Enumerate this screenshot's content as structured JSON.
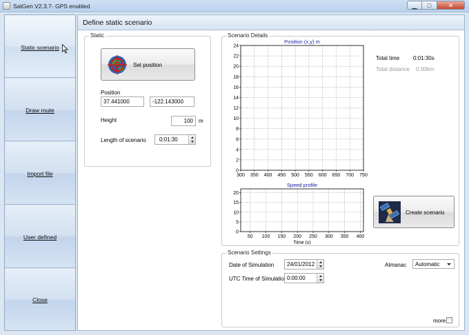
{
  "window": {
    "title": "SatGen V2.3.7- GPS enabled",
    "min_glyph": "▁",
    "max_glyph": "□",
    "close_glyph": "✕"
  },
  "nav": {
    "items": [
      {
        "label": "Static scenario"
      },
      {
        "label": "Draw route"
      },
      {
        "label": "Import file"
      },
      {
        "label": "User defined"
      },
      {
        "label": "Close"
      }
    ]
  },
  "header": {
    "title": "Define static scenario"
  },
  "static_group": {
    "title": "Static",
    "set_position_label": "Set position",
    "position_label": "Position",
    "latitude": "37.441000",
    "longitude": "-122.143000",
    "height_label": "Height",
    "height_value": "100",
    "height_unit": "m",
    "length_label": "Length of scenario",
    "length_value": "0:01:30"
  },
  "details_group": {
    "title": "Scenario Details",
    "total_time_label": "Total time",
    "total_time_value": "0:01:30s",
    "total_distance_label": "Total distance",
    "total_distance_value": "0.00km",
    "create_scenario_label": "Create scenario"
  },
  "settings_group": {
    "title": "Scenario Settings",
    "date_label": "Date of Simulation",
    "date_value": "24/01/2012",
    "utc_label": "UTC Time of Simulation",
    "utc_value": "0:00:00",
    "almanac_label": "Almanac",
    "almanac_value": "Automatic",
    "more_label": "more"
  },
  "chart_data": [
    {
      "type": "scatter",
      "title": "Position (x,y) m",
      "xlabel": "",
      "ylabel": "",
      "xticks": [
        300,
        350,
        400,
        450,
        500,
        550,
        600,
        650,
        700,
        750
      ],
      "yticks": [
        0,
        2,
        4,
        6,
        8,
        10,
        12,
        14,
        16,
        18,
        20,
        22,
        24
      ],
      "xlim": [
        300,
        750
      ],
      "ylim": [
        0,
        24
      ],
      "grid": true,
      "points": []
    },
    {
      "type": "line",
      "title": "Speed profile",
      "xlabel": "Time (s)",
      "ylabel": "",
      "xticks": [
        50,
        100,
        150,
        200,
        250,
        300,
        350,
        400
      ],
      "yticks": [
        0,
        5,
        10,
        15,
        20
      ],
      "xlim": [
        20,
        410
      ],
      "ylim": [
        0,
        22
      ],
      "grid": true,
      "series": []
    }
  ],
  "colors": {
    "chart_title": "#1a1aa6",
    "grid": "#8a8a8a"
  },
  "icons": {
    "set_position": "crosshair-target-icon",
    "create_scenario": "satellite-icon",
    "app": "app-icon"
  }
}
